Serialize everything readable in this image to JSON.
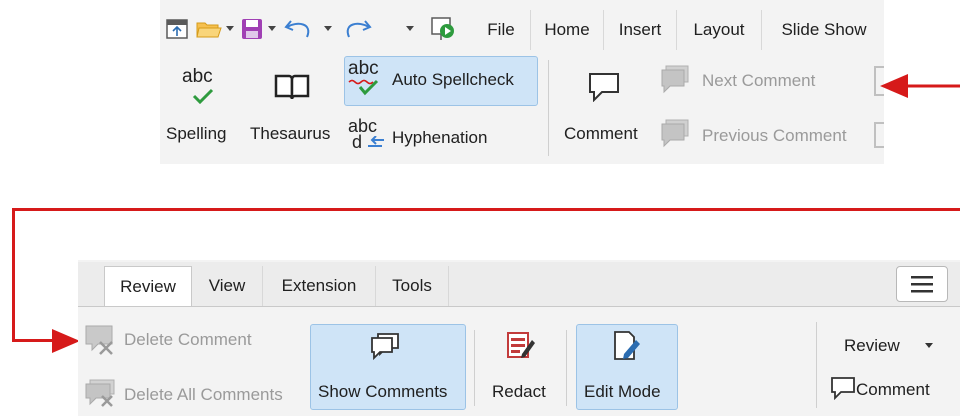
{
  "top_ribbon": {
    "tabs": [
      "File",
      "Home",
      "Insert",
      "Layout",
      "Slide Show"
    ],
    "buttons": {
      "spelling": "Spelling",
      "thesaurus": "Thesaurus",
      "auto_spellcheck": "Auto Spellcheck",
      "hyphenation": "Hyphenation",
      "comment": "Comment",
      "next_comment": "Next Comment",
      "previous_comment": "Previous Comment"
    },
    "glyphs": {
      "abc": "abc",
      "abc_hyphen_top": "abc",
      "abc_hyphen_bottom": "d"
    }
  },
  "bottom_ribbon": {
    "tabs": [
      "Review",
      "View",
      "Extension",
      "Tools"
    ],
    "selected_tab": "Review",
    "buttons": {
      "delete_comment": "Delete Comment",
      "delete_all_comments": "Delete All Comments",
      "show_comments": "Show Comments",
      "redact": "Redact",
      "edit_mode": "Edit Mode",
      "review_dropdown": "Review",
      "comment": "Comment"
    }
  },
  "icons": [
    "new-presentation-icon",
    "open-folder-icon",
    "save-icon",
    "undo-icon",
    "redo-icon",
    "start-slideshow-icon",
    "spelling-icon",
    "thesaurus-icon",
    "auto-spellcheck-icon",
    "hyphenation-icon",
    "comment-icon",
    "next-comment-icon",
    "previous-comment-icon",
    "delete-comment-icon",
    "delete-all-comments-icon",
    "show-comments-icon",
    "redact-icon",
    "edit-mode-icon",
    "hamburger-menu-icon",
    "dropdown-arrow-icon"
  ],
  "colors": {
    "annotation_red": "#d61a1a",
    "highlight": "#cfe4f7",
    "panel": "#f3f3f3"
  }
}
